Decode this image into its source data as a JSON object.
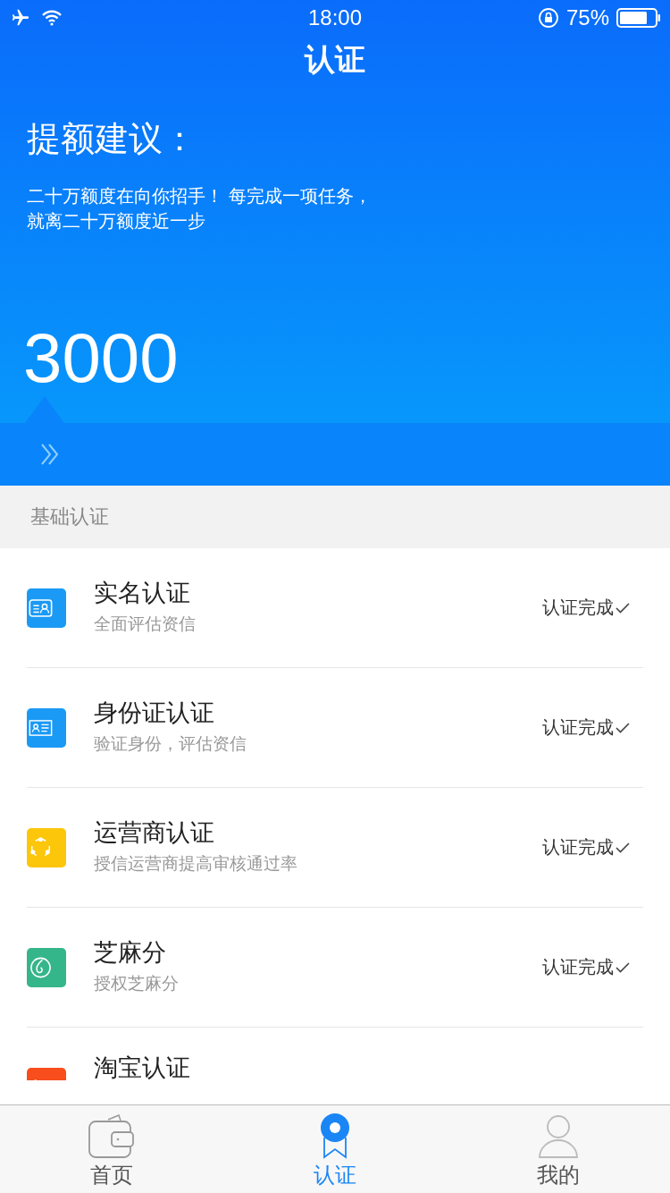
{
  "status_bar": {
    "time": "18:00",
    "battery": "75%"
  },
  "header": {
    "title": "认证",
    "heading": "提额建议：",
    "description": [
      "二十万额度在向你招手！ 每完成一项任务，",
      "就离二十万额度近一步"
    ],
    "amount": "3000"
  },
  "section": {
    "title": "基础认证"
  },
  "items": [
    {
      "kind": "name",
      "title": "实名认证",
      "subtitle": "全面评估资信",
      "status": "认证完成",
      "done": true,
      "color": "#1a9af5"
    },
    {
      "kind": "idcard",
      "title": "身份证认证",
      "subtitle": "验证身份，评估资信",
      "status": "认证完成",
      "done": true,
      "color": "#1a9af5"
    },
    {
      "kind": "carrier",
      "title": "运营商认证",
      "subtitle": "授信运营商提高审核通过率",
      "status": "认证完成",
      "done": true,
      "color": "#fcc60a"
    },
    {
      "kind": "sesame",
      "title": "芝麻分",
      "subtitle": "授权芝麻分",
      "status": "认证完成",
      "done": true,
      "color": "#35b58a"
    },
    {
      "kind": "taobao",
      "title": "淘宝认证",
      "color": "#f84d1c"
    }
  ],
  "tabs": [
    {
      "kind": "home",
      "label": "首页",
      "selected": false
    },
    {
      "kind": "verify",
      "label": "认证",
      "selected": true
    },
    {
      "kind": "me",
      "label": "我的",
      "selected": false
    }
  ]
}
